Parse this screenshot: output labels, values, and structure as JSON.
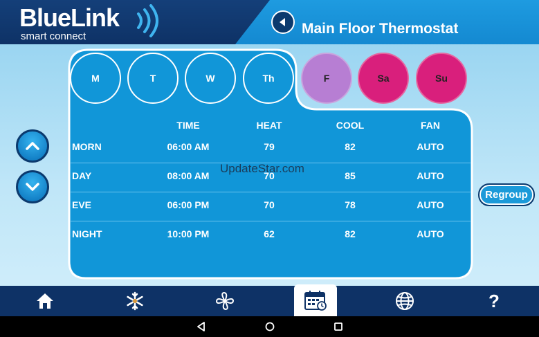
{
  "header": {
    "logo_main": "BlueLink",
    "logo_sub": "smart connect",
    "title": "Main Floor Thermostat",
    "back_icon": "back-arrow-icon"
  },
  "days": [
    {
      "label": "M",
      "state": "weekday"
    },
    {
      "label": "T",
      "state": "weekday"
    },
    {
      "label": "W",
      "state": "weekday"
    },
    {
      "label": "Th",
      "state": "weekday"
    },
    {
      "label": "F",
      "state": "friday"
    },
    {
      "label": "Sa",
      "state": "weekend"
    },
    {
      "label": "Su",
      "state": "weekend"
    }
  ],
  "schedule": {
    "columns": [
      "",
      "TIME",
      "HEAT",
      "COOL",
      "FAN"
    ],
    "rows": [
      {
        "period": "MORN",
        "time": "06:00 AM",
        "heat": "79",
        "cool": "82",
        "fan": "AUTO"
      },
      {
        "period": "DAY",
        "time": "08:00 AM",
        "heat": "70",
        "cool": "85",
        "fan": "AUTO"
      },
      {
        "period": "EVE",
        "time": "06:00 PM",
        "heat": "70",
        "cool": "78",
        "fan": "AUTO"
      },
      {
        "period": "NIGHT",
        "time": "10:00 PM",
        "heat": "62",
        "cool": "82",
        "fan": "AUTO"
      }
    ]
  },
  "controls": {
    "regroup_label": "Regroup",
    "up_icon": "chevron-up-icon",
    "down_icon": "chevron-down-icon"
  },
  "watermark": "UpdateStar.com",
  "nav": {
    "items": [
      "home-icon",
      "snowflake-icon",
      "fan-icon",
      "calendar-icon",
      "globe-icon",
      "help-icon"
    ],
    "help_glyph": "?",
    "active": "calendar-icon"
  },
  "system_bar": [
    "back-triangle-icon",
    "home-circle-icon",
    "recents-square-icon"
  ],
  "colors": {
    "navy": "#0e3266",
    "blue": "#1196d8",
    "friday": "#b77ed3",
    "weekend": "#d91f7c"
  }
}
